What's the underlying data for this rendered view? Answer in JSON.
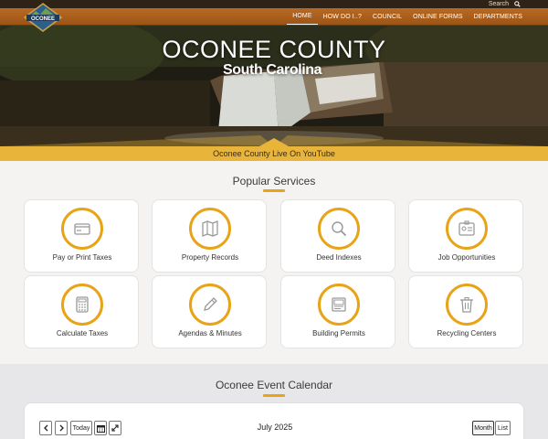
{
  "header": {
    "search_label": "Search",
    "nav": [
      {
        "label": "HOME",
        "active": true
      },
      {
        "label": "HOW DO I..?",
        "active": false
      },
      {
        "label": "COUNCIL",
        "active": false
      },
      {
        "label": "ONLINE FORMS",
        "active": false
      },
      {
        "label": "DEPARTMENTS",
        "active": false
      }
    ],
    "logo_text": "OCONEE"
  },
  "hero": {
    "title": "OCONEE COUNTY",
    "subtitle": "South Carolina"
  },
  "youtube_band": {
    "label": "Oconee County Live On YouTube"
  },
  "services": {
    "title": "Popular Services",
    "items": [
      {
        "label": "Pay or Print Taxes",
        "icon": "credit-card-icon"
      },
      {
        "label": "Property Records",
        "icon": "map-icon"
      },
      {
        "label": "Deed Indexes",
        "icon": "magnifier-icon"
      },
      {
        "label": "Job Opportunities",
        "icon": "id-badge-icon"
      },
      {
        "label": "Calculate Taxes",
        "icon": "calculator-icon"
      },
      {
        "label": "Agendas & Minutes",
        "icon": "pencil-icon"
      },
      {
        "label": "Building Permits",
        "icon": "permit-document-icon"
      },
      {
        "label": "Recycling Centers",
        "icon": "trash-can-icon"
      }
    ]
  },
  "calendar": {
    "title": "Oconee Event Calendar",
    "today_label": "Today",
    "month_label": "July 2025",
    "view_month": "Month",
    "view_list": "List"
  },
  "colors": {
    "accent": "#e8a317",
    "nav_brown": "#a85d1a",
    "band_gold": "#e8b43a"
  }
}
